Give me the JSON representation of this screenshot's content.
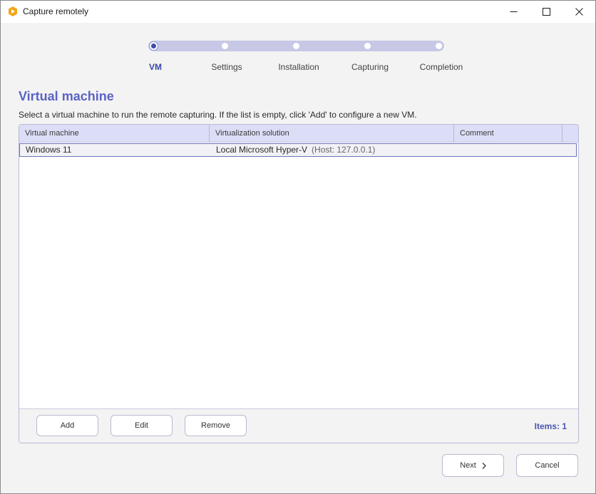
{
  "window": {
    "title": "Capture remotely",
    "icon": "app-logo-icon",
    "controls": [
      "minimize-icon",
      "maximize-icon",
      "close-icon"
    ]
  },
  "stepper": {
    "steps": [
      "VM",
      "Settings",
      "Installation",
      "Capturing",
      "Completion"
    ],
    "active_index": 0
  },
  "main": {
    "title": "Virtual machine",
    "description": "Select a virtual machine to run the remote capturing. If the list is empty, click 'Add' to configure a new VM."
  },
  "table": {
    "columns": [
      "Virtual machine",
      "Virtualization solution",
      "Comment"
    ],
    "rows": [
      {
        "vm": "Windows 11",
        "solution": "Local Microsoft Hyper-V",
        "host": "(Host: 127.0.0.1)",
        "comment": ""
      }
    ]
  },
  "panel_footer": {
    "add_label": "Add",
    "edit_label": "Edit",
    "remove_label": "Remove",
    "items_count": "Items: 1"
  },
  "footer": {
    "next_label": "Next",
    "cancel_label": "Cancel"
  },
  "colors": {
    "accent": "#5b63c5",
    "step_track": "#c7c8e6",
    "header_bg": "#dcdef7"
  }
}
